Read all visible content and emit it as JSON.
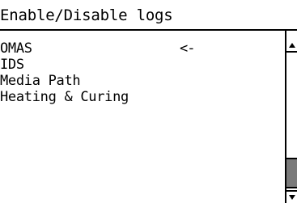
{
  "title": "Enable/Disable logs",
  "list": {
    "items": [
      {
        "label": "OMAS"
      },
      {
        "label": "IDS"
      },
      {
        "label": "Media Path"
      },
      {
        "label": "Heating & Curing"
      }
    ],
    "selected_marker": "<-"
  },
  "scrollbar": {
    "up_icon": "triangle-up-icon",
    "down_icon": "triangle-down-icon",
    "position_fraction": 0.85
  },
  "colors": {
    "background": "#ffffff",
    "foreground": "#000000",
    "thumb": "#7a7a7a"
  }
}
